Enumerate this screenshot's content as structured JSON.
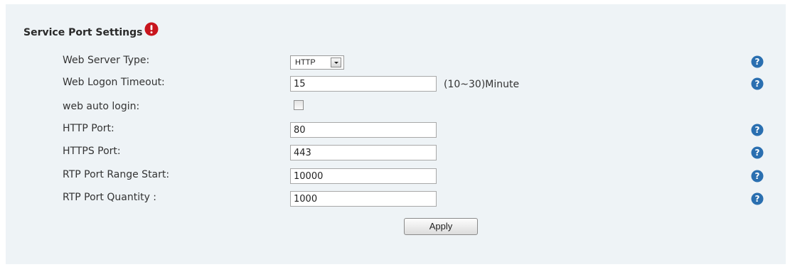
{
  "section": {
    "title": "Service Port Settings",
    "warning_icon": "alert-circle-icon",
    "help_icon": "question-circle-icon",
    "accent_color": "#2a6fb0",
    "warning_color": "#c8151d"
  },
  "fields": {
    "web_server_type": {
      "label": "Web Server Type:",
      "value": "HTTP"
    },
    "web_logon_timeout": {
      "label": "Web Logon Timeout:",
      "value": "15",
      "unit": "(10~30)Minute"
    },
    "web_auto_login": {
      "label": "web auto login:",
      "checked": false
    },
    "http_port": {
      "label": "HTTP Port:",
      "value": "80"
    },
    "https_port": {
      "label": "HTTPS Port:",
      "value": "443"
    },
    "rtp_port_range_start": {
      "label": "RTP Port Range Start:",
      "value": "10000"
    },
    "rtp_port_quantity": {
      "label": "RTP Port Quantity :",
      "value": "1000"
    }
  },
  "actions": {
    "apply_label": "Apply"
  }
}
